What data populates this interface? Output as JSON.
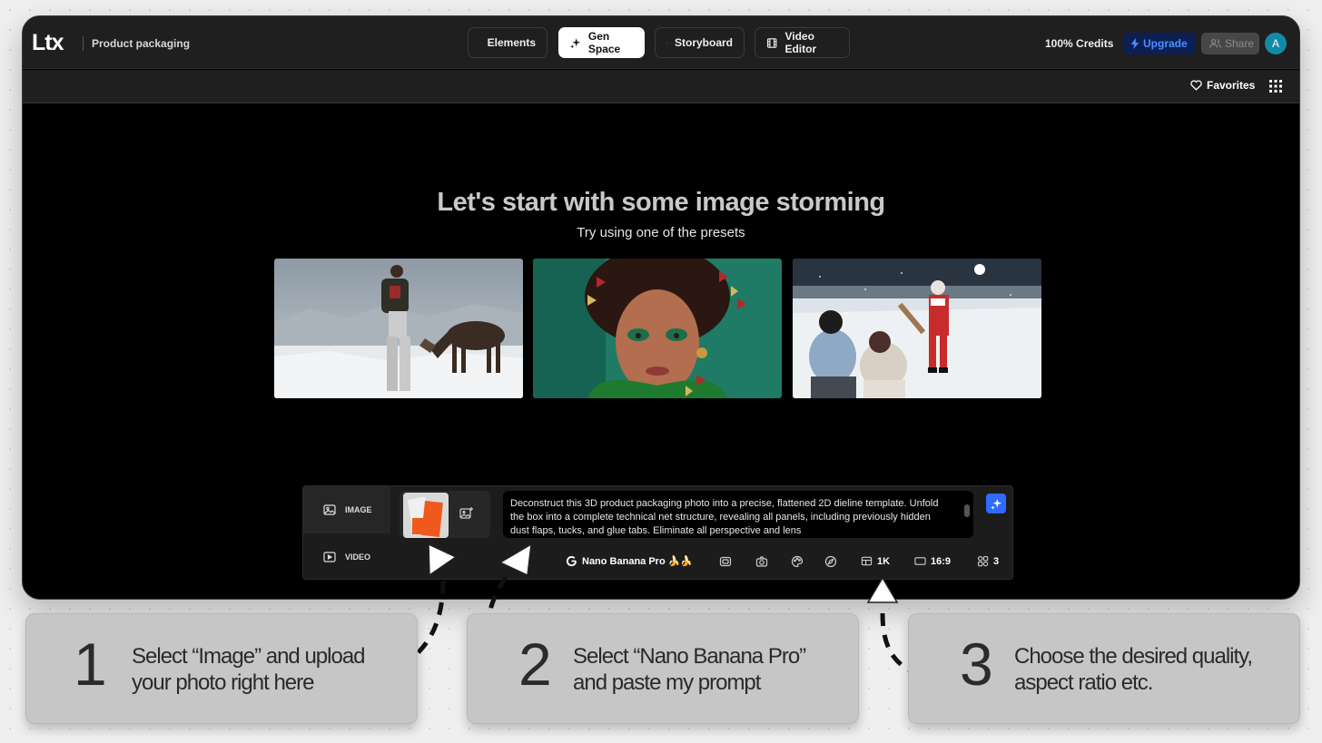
{
  "topbar": {
    "logo": "Ltx",
    "project_name": "Product packaging",
    "tabs": [
      {
        "label": "Elements",
        "icon": "cube-icon"
      },
      {
        "label": "Gen Space",
        "icon": "sparkles-icon",
        "active": true
      },
      {
        "label": "Storyboard",
        "icon": "clapperboard-icon"
      },
      {
        "label": "Video Editor",
        "icon": "film-icon"
      }
    ],
    "credits": "100% Credits",
    "upgrade_label": "Upgrade",
    "share_label": "Share",
    "avatar_letter": "A"
  },
  "subbar": {
    "favorites_label": "Favorites"
  },
  "hero": {
    "title": "Let's start with some image storming",
    "subtitle": "Try using one of the presets"
  },
  "composer": {
    "modes": [
      {
        "label": "IMAGE",
        "icon": "image-icon",
        "active": true
      },
      {
        "label": "VIDEO",
        "icon": "play-icon",
        "active": false
      }
    ],
    "prompt_text": "Deconstruct this 3D product packaging photo into a precise, flattened 2D dieline template. Unfold the box into a complete technical net structure, revealing all panels, including previously hidden dust flaps, tucks, and glue tabs. Eliminate all perspective and lens",
    "model_label": "Nano Banana Pro 🍌🍌",
    "quality": "1K",
    "aspect_ratio": "16:9",
    "count": "3"
  },
  "cards": [
    {
      "number": "1",
      "text": "Select “Image” and upload\nyour photo right here"
    },
    {
      "number": "2",
      "text": "Select “Nano Banana Pro”\nand paste my prompt"
    },
    {
      "number": "3",
      "text": "Choose the desired quality,\naspect ratio etc."
    }
  ],
  "colors": {
    "accent_blue": "#2f6bff",
    "upgrade_bg": "#0c1f55",
    "avatar_bg": "#128aa6"
  }
}
